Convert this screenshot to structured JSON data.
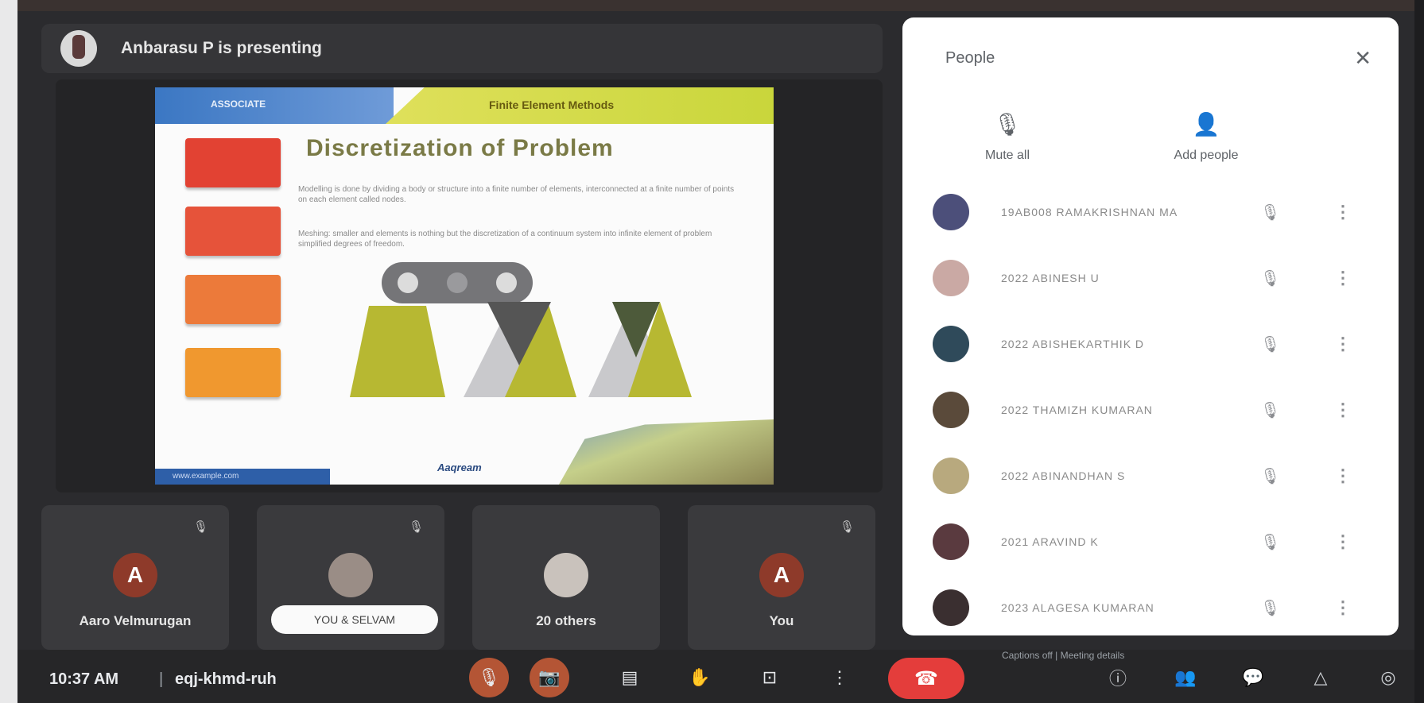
{
  "meeting": {
    "presenter_text": "Anbarasu P is presenting",
    "time": "10:37 AM",
    "separator": "|",
    "code": "eqj-khmd-ruh"
  },
  "slide": {
    "header_left": "ASSOCIATE",
    "header_right": "Finite Element Methods",
    "title": "Discretization of Problem",
    "bullet1": "Modelling is done by dividing a body or structure into a finite number of elements, interconnected at a finite number of points on each element called nodes.",
    "bullet2": "Meshing: smaller and elements is nothing but the discretization of a continuum system into infinite element of problem simplified degrees of freedom.",
    "footer_left": "www.example.com",
    "logo": "Aaqream"
  },
  "tiles": [
    {
      "avatar_letter": "A",
      "name": "Aaro Velmurugan",
      "avatar_color": "#8e3a2a"
    },
    {
      "chip": "YOU & SELVAM"
    },
    {
      "name": "20 others"
    },
    {
      "avatar_letter": "A",
      "name": "You",
      "avatar_color": "#8e3a2a"
    }
  ],
  "people_panel": {
    "title": "People",
    "close_icon": "close-icon",
    "mute_all_label": "Mute all",
    "add_people_label": "Add people",
    "people": [
      {
        "name": "19AB008 RAMAKRISHNAN MA",
        "avatar_color": "#4c4f7a"
      },
      {
        "name": "2022 ABINESH U",
        "avatar_color": "#caa9a4"
      },
      {
        "name": "2022 ABISHEKARTHIK D",
        "avatar_color": "#2f4a5a"
      },
      {
        "name": "2022 THAMIZH KUMARAN",
        "avatar_color": "#5a4a3a"
      },
      {
        "name": "2022 ABINANDHAN S",
        "avatar_color": "#b8a97e"
      },
      {
        "name": "2021 ARAVIND K",
        "avatar_color": "#5a3a3f"
      },
      {
        "name": "2023 ALAGESA KUMARAN",
        "avatar_color": "#3a2f30"
      }
    ]
  },
  "controls": {
    "hint": "Captions off | Meeting details",
    "end_call_icon": "call-end-icon"
  }
}
